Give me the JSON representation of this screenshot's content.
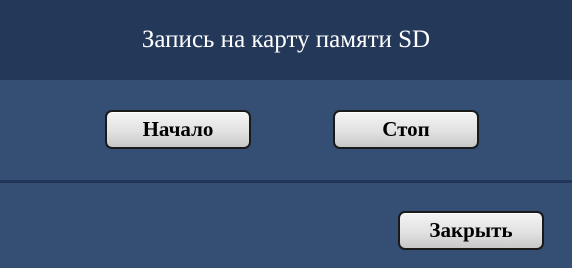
{
  "dialog": {
    "title": "Запись на карту памяти SD",
    "buttons": {
      "start_label": "Начало",
      "stop_label": "Стоп",
      "close_label": "Закрыть"
    }
  },
  "colors": {
    "title_bar": "#24385a",
    "panel": "#344f73",
    "divider": "#22365a",
    "button_face": "#e2e2e2"
  }
}
